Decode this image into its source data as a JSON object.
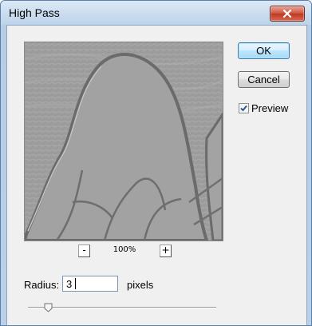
{
  "window": {
    "title": "High Pass"
  },
  "buttons": {
    "ok_label": "OK",
    "cancel_label": "Cancel"
  },
  "preview": {
    "label": "Preview",
    "checked": true
  },
  "zoom": {
    "minus_label": "-",
    "level": "100%",
    "plus_label": "+"
  },
  "radius": {
    "label": "Radius:",
    "value": "3",
    "unit": "pixels",
    "slider_position": 0.08
  },
  "colors": {
    "title_bar": "#bcd3ea",
    "close_button": "#c0371f",
    "default_button_border": "#3c7fb1",
    "dialog_body": "#f0f0f0"
  },
  "icons": {
    "close": "close-icon",
    "checkmark": "checkmark-icon",
    "slider_thumb": "slider-thumb-icon"
  }
}
